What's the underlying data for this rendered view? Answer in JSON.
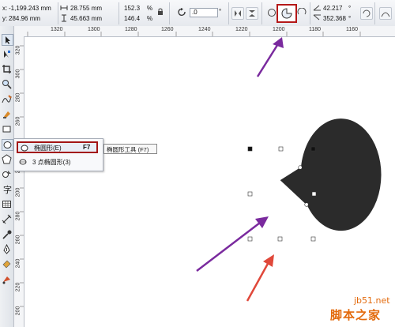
{
  "propbar": {
    "x_label": "x:",
    "x_value": "-1,199.243 mm",
    "y_label": "y:",
    "y_value": "284.96 mm",
    "width_value": "28.755 mm",
    "height_value": "45.663 mm",
    "scale_x": "152.3",
    "scale_y": "146.4",
    "percent_1": "%",
    "percent_2": "%",
    "rotation_value": ".0",
    "degree_symbol": "°",
    "start_angle": "42.217",
    "end_angle": "352.368",
    "angle_symbol_1": "°",
    "angle_symbol_2": "°"
  },
  "ruler_top": {
    "labels": [
      "1320",
      "1300",
      "1280",
      "1260",
      "1240",
      "1220",
      "1200",
      "1180",
      "1160"
    ]
  },
  "ruler_left": {
    "labels": [
      "320",
      "300",
      "280",
      "260",
      "240",
      "220",
      "200",
      "280",
      "260",
      "240",
      "220",
      "200"
    ]
  },
  "flyout": {
    "item1_label": "椭圆形(E)",
    "item1_shortcut": "F7",
    "item2_label": "3 点椭圆形(3)",
    "tooltip": "椭圆形工具 (F7)"
  },
  "watermark": {
    "line1": "jb51.net",
    "line2": "脚本之家"
  },
  "colors": {
    "ellipse": "#2b2b2b",
    "highlight": "#b41818",
    "purple_arrow": "#7a2a9e",
    "red_arrow": "#e0483a",
    "watermark": "#e36a0c"
  },
  "icons": [
    "pick-tool-icon",
    "shape-tool-icon",
    "crop-tool-icon",
    "zoom-tool-icon",
    "freehand-tool-icon",
    "smart-fill-icon",
    "rectangle-tool-icon",
    "ellipse-tool-icon",
    "polygon-tool-icon",
    "text-tool-icon",
    "table-tool-icon",
    "dimension-tool-icon",
    "eyedropper-icon",
    "outline-pen-icon",
    "fill-tool-icon",
    "interactive-fill-icon"
  ]
}
